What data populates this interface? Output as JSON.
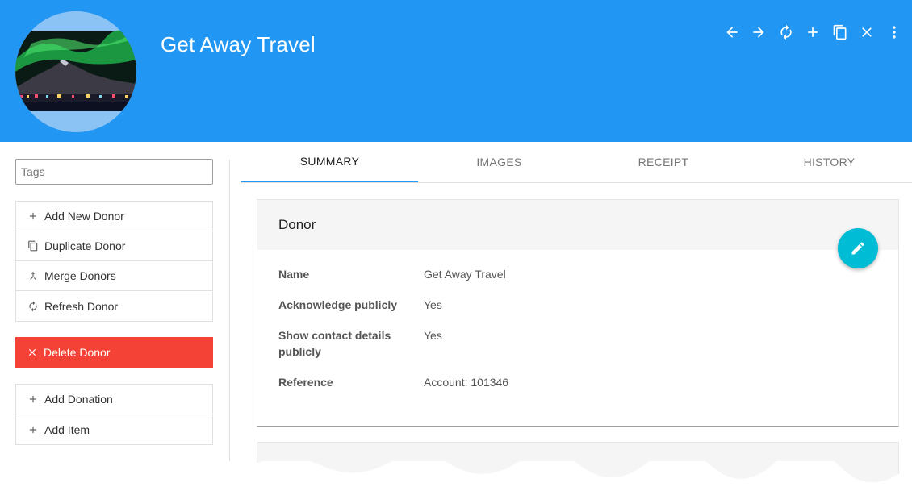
{
  "header": {
    "title": "Get Away Travel",
    "background": "#2196F3",
    "avatar_icon": "aurora-landscape-photo",
    "toolbar": [
      {
        "name": "back-arrow-icon"
      },
      {
        "name": "forward-arrow-icon"
      },
      {
        "name": "refresh-icon"
      },
      {
        "name": "add-icon"
      },
      {
        "name": "copy-icon"
      },
      {
        "name": "close-icon"
      },
      {
        "name": "more-vert-icon"
      }
    ]
  },
  "left": {
    "tags_placeholder": "Tags",
    "group1": [
      {
        "label": "Add New Donor",
        "icon": "add-icon"
      },
      {
        "label": "Duplicate Donor",
        "icon": "copy-icon"
      },
      {
        "label": "Merge Donors",
        "icon": "merge-icon"
      },
      {
        "label": "Refresh Donor",
        "icon": "refresh-icon"
      }
    ],
    "delete_label": "Delete Donor",
    "delete_color": "#F44336",
    "group2": [
      {
        "label": "Add Donation",
        "icon": "add-icon"
      },
      {
        "label": "Add Item",
        "icon": "add-icon"
      }
    ]
  },
  "tabs": [
    {
      "label": "SUMMARY",
      "active": true
    },
    {
      "label": "IMAGES",
      "active": false
    },
    {
      "label": "RECEIPT",
      "active": false
    },
    {
      "label": "HISTORY",
      "active": false
    }
  ],
  "card": {
    "title": "Donor",
    "fields": [
      {
        "key": "Name",
        "value": "Get Away Travel"
      },
      {
        "key": "Acknowledge publicly",
        "value": "Yes"
      },
      {
        "key": "Show contact details publicly",
        "value": "Yes"
      },
      {
        "key": "Reference",
        "value": "Account: 101346"
      }
    ],
    "edit_icon": "pencil-icon",
    "fab_color": "#00BCD4"
  }
}
